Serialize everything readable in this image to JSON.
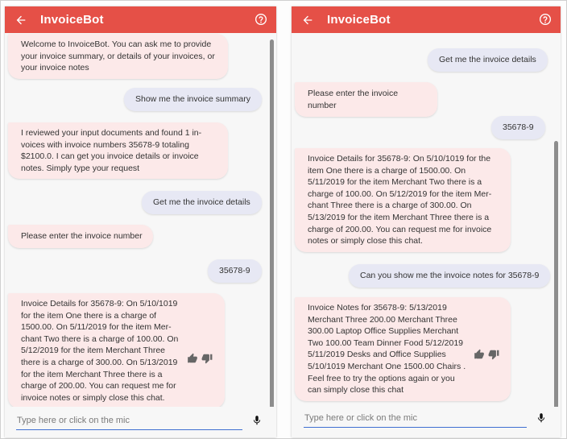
{
  "colors": {
    "appbar": "#e55047",
    "bot_bubble": "#fce9e9",
    "user_bubble": "#e7e8f4",
    "input_underline": "#3f6fd1"
  },
  "app": {
    "title": "InvoiceBot",
    "back_icon": "arrow-left-icon",
    "help_icon": "help-circle-icon",
    "mic_icon": "microphone-icon"
  },
  "left_panel": {
    "messages": [
      {
        "from": "bot",
        "text": "Welcome to InvoiceBot. You can ask me to provide\nyour invoice summary, or details of your invoices, or\nyour invoice notes"
      },
      {
        "from": "user",
        "text": "Show me the invoice summary"
      },
      {
        "from": "bot",
        "text": "I reviewed your input documents and found 1 in-\nvoices with invoice numbers 35678-9 totaling\n$2100.0. I can get you invoice details or invoice\nnotes. Simply type your request"
      },
      {
        "from": "user",
        "text": "Get me the invoice details"
      },
      {
        "from": "bot",
        "text": "Please enter the invoice number"
      },
      {
        "from": "user",
        "text": "35678-9"
      },
      {
        "from": "bot",
        "text": "Invoice Details for 35678-9: On 5/10/1019\nfor the item One there is a charge of\n1500.00. On 5/11/2019 for the item Mer-\nchant Two there is a charge of 100.00. On\n5/12/2019 for the item Merchant Three\nthere is a charge of 300.00. On 5/13/2019\nfor the item Merchant Three there is a\ncharge of 200.00. You can request me for\ninvoice notes or simply close this chat."
      }
    ],
    "input_placeholder": "Type here or click on the mic"
  },
  "right_panel": {
    "messages": [
      {
        "from": "user",
        "text": "Get me the invoice details"
      },
      {
        "from": "bot",
        "text": "Please enter the invoice number"
      },
      {
        "from": "user",
        "text": "35678-9"
      },
      {
        "from": "bot",
        "text": "Invoice Details for 35678-9: On 5/10/1019 for the\nitem One there is a charge of 1500.00. On\n5/11/2019 for the item Merchant Two there is a\ncharge of 100.00. On 5/12/2019 for the item Mer-\nchant Three there is a charge of 300.00. On\n5/13/2019 for the item Merchant Three there is a\ncharge of 200.00. You can request me for invoice\nnotes or simply close this chat."
      },
      {
        "from": "user",
        "text": "Can you show me the invoice notes for 35678-9"
      },
      {
        "from": "bot",
        "text": "Invoice Notes for 35678-9: 5/13/2019\nMerchant Three 200.00 Merchant Three\n300.00 Laptop Office Supplies Merchant\nTwo 100.00 Team Dinner Food 5/12/2019\n5/11/2019 Desks and Office Supplies\n5/10/1019 Merchant One 1500.00 Chairs .\nFeel free to try the options again or you\ncan simply close this chat"
      }
    ],
    "input_placeholder": "Type here or click on the mic"
  }
}
